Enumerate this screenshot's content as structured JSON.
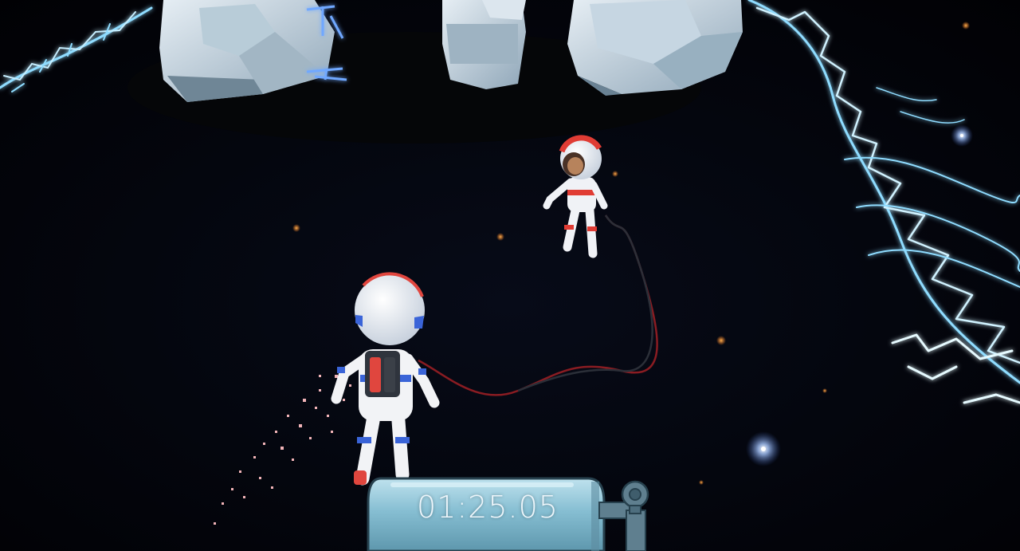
{
  "hud": {
    "timer": "01:25.05"
  },
  "scene": {
    "background_color": "#020308",
    "energy_color": "#7fd8ff",
    "player_suit_colors": [
      "#f4f4f6",
      "#3a64d8",
      "#e0463e"
    ],
    "partner_suit_colors": [
      "#f4f4f6",
      "#e03c34"
    ],
    "tether_color": "#8a1c22",
    "tank_color": "#7fb7cc"
  },
  "icons": [
    "oxygen-tank-icon",
    "valve-pipe-icon"
  ]
}
